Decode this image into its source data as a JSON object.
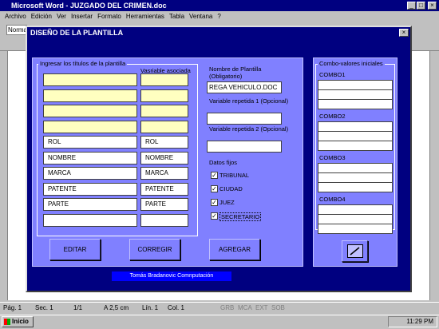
{
  "word": {
    "title": "Microsoft Word - JUZGADO DEL CRIMEN.doc",
    "menu": [
      "Archivo",
      "Edición",
      "Ver",
      "Insertar",
      "Formato",
      "Herramientas",
      "Tabla",
      "Ventana",
      "?"
    ],
    "style_value": "Normal",
    "status": {
      "page": "Pág. 1",
      "sec": "Sec. 1",
      "pages": "1/1",
      "at": "A 2,5 cm",
      "line": "Lín. 1",
      "col": "Col. 1",
      "rec": "GRB",
      "rev": "MCA",
      "ext": "EXT",
      "sob": "SOB"
    },
    "taskbar": {
      "start": "Inicio",
      "clock": "11:29 PM"
    }
  },
  "dialog": {
    "title": "DISEÑO DE LA PLANTILLA",
    "close": "×",
    "titles_frame": "Ingresar los títulos de la plantilla",
    "var_header": "Vasriable asociada",
    "titles": [
      "",
      "",
      "",
      "",
      "ROL",
      "NOMBRE",
      "MARCA",
      "PATENTE",
      "PARTE",
      ""
    ],
    "vars": [
      "",
      "",
      "",
      "",
      "ROL",
      "NOMBRE",
      "MARCA",
      "PATENTE",
      "PARTE",
      ""
    ],
    "template_name_label": "Nombre de Plantilla (Obligatorio)",
    "template_name_value": "REGA VEHICULO.DOC",
    "rep1_label": "Variable repetida 1 (Opcional)",
    "rep2_label": "Variable repetida 2 (Opcional)",
    "fixed_label": "Datos fijos",
    "fixed": [
      {
        "label": "TRIBUNAL",
        "checked": true
      },
      {
        "label": "CIUDAD",
        "checked": true
      },
      {
        "label": "JUEZ",
        "checked": true
      },
      {
        "label": "SECRETARIO",
        "checked": true
      }
    ],
    "buttons": {
      "edit": "EDITAR",
      "fix": "CORREGIR",
      "add": "AGREGAR"
    },
    "combo_frame": "Combo-valores iniciales",
    "combos": [
      "COMBO1",
      "COMBO2",
      "COMBO3",
      "COMBO4"
    ],
    "footer": "Tomás Bradanovic Comnputación"
  }
}
